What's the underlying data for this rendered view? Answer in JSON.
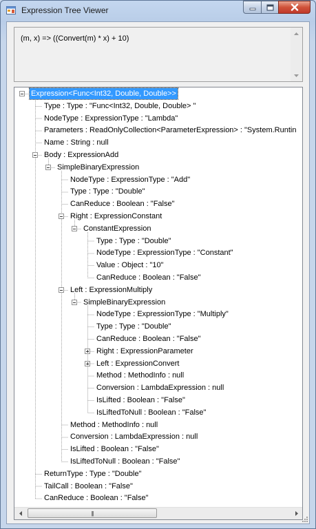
{
  "window": {
    "title": "Expression Tree Viewer"
  },
  "expression": {
    "text": "(m, x) => ((Convert(m) * x) + 10)"
  },
  "tree": {
    "nodes": [
      {
        "label": "Expression<Func<Int32, Double, Double>>",
        "level": 0,
        "expander": "minus",
        "selected": true
      },
      {
        "label": "Type : Type : \"Func<Int32, Double, Double> \"",
        "level": 1,
        "expander": null
      },
      {
        "label": "NodeType : ExpressionType : \"Lambda\"",
        "level": 1,
        "expander": null
      },
      {
        "label": "Parameters : ReadOnlyCollection<ParameterExpression> : \"System.Runtin",
        "level": 1,
        "expander": null
      },
      {
        "label": "Name : String : null",
        "level": 1,
        "expander": null
      },
      {
        "label": "Body : ExpressionAdd",
        "level": 1,
        "expander": "minus"
      },
      {
        "label": "SimpleBinaryExpression",
        "level": 2,
        "expander": "minus"
      },
      {
        "label": "NodeType : ExpressionType : \"Add\"",
        "level": 3,
        "expander": null
      },
      {
        "label": "Type : Type : \"Double\"",
        "level": 3,
        "expander": null
      },
      {
        "label": "CanReduce : Boolean : \"False\"",
        "level": 3,
        "expander": null
      },
      {
        "label": "Right : ExpressionConstant",
        "level": 3,
        "expander": "minus"
      },
      {
        "label": "ConstantExpression",
        "level": 4,
        "expander": "minus"
      },
      {
        "label": "Type : Type : \"Double\"",
        "level": 5,
        "expander": null
      },
      {
        "label": "NodeType : ExpressionType : \"Constant\"",
        "level": 5,
        "expander": null
      },
      {
        "label": "Value : Object : \"10\"",
        "level": 5,
        "expander": null
      },
      {
        "label": "CanReduce : Boolean : \"False\"",
        "level": 5,
        "expander": null
      },
      {
        "label": "Left : ExpressionMultiply",
        "level": 3,
        "expander": "minus"
      },
      {
        "label": "SimpleBinaryExpression",
        "level": 4,
        "expander": "minus"
      },
      {
        "label": "NodeType : ExpressionType : \"Multiply\"",
        "level": 5,
        "expander": null
      },
      {
        "label": "Type : Type : \"Double\"",
        "level": 5,
        "expander": null
      },
      {
        "label": "CanReduce : Boolean : \"False\"",
        "level": 5,
        "expander": null
      },
      {
        "label": "Right : ExpressionParameter",
        "level": 5,
        "expander": "plus"
      },
      {
        "label": "Left : ExpressionConvert",
        "level": 5,
        "expander": "plus"
      },
      {
        "label": "Method : MethodInfo : null",
        "level": 5,
        "expander": null
      },
      {
        "label": "Conversion : LambdaExpression : null",
        "level": 5,
        "expander": null
      },
      {
        "label": "IsLifted : Boolean : \"False\"",
        "level": 5,
        "expander": null
      },
      {
        "label": "IsLiftedToNull : Boolean : \"False\"",
        "level": 5,
        "expander": null
      },
      {
        "label": "Method : MethodInfo : null",
        "level": 3,
        "expander": null
      },
      {
        "label": "Conversion : LambdaExpression : null",
        "level": 3,
        "expander": null
      },
      {
        "label": "IsLifted : Boolean : \"False\"",
        "level": 3,
        "expander": null
      },
      {
        "label": "IsLiftedToNull : Boolean : \"False\"",
        "level": 3,
        "expander": null
      },
      {
        "label": "ReturnType : Type : \"Double\"",
        "level": 1,
        "expander": null
      },
      {
        "label": "TailCall : Boolean : \"False\"",
        "level": 1,
        "expander": null
      },
      {
        "label": "CanReduce : Boolean : \"False\"",
        "level": 1,
        "expander": null
      }
    ]
  },
  "icons": {
    "app": "app-window-icon",
    "minimize": "minimize-icon",
    "maximize": "maximize-icon",
    "close": "close-icon",
    "scroll_up": "scroll-up-icon",
    "scroll_down": "scroll-down-icon",
    "scroll_left": "scroll-left-icon",
    "scroll_right": "scroll-right-icon"
  },
  "colors": {
    "selection": "#3399ff",
    "close_button": "#c0392b",
    "title_bar": "#b9cde8"
  }
}
